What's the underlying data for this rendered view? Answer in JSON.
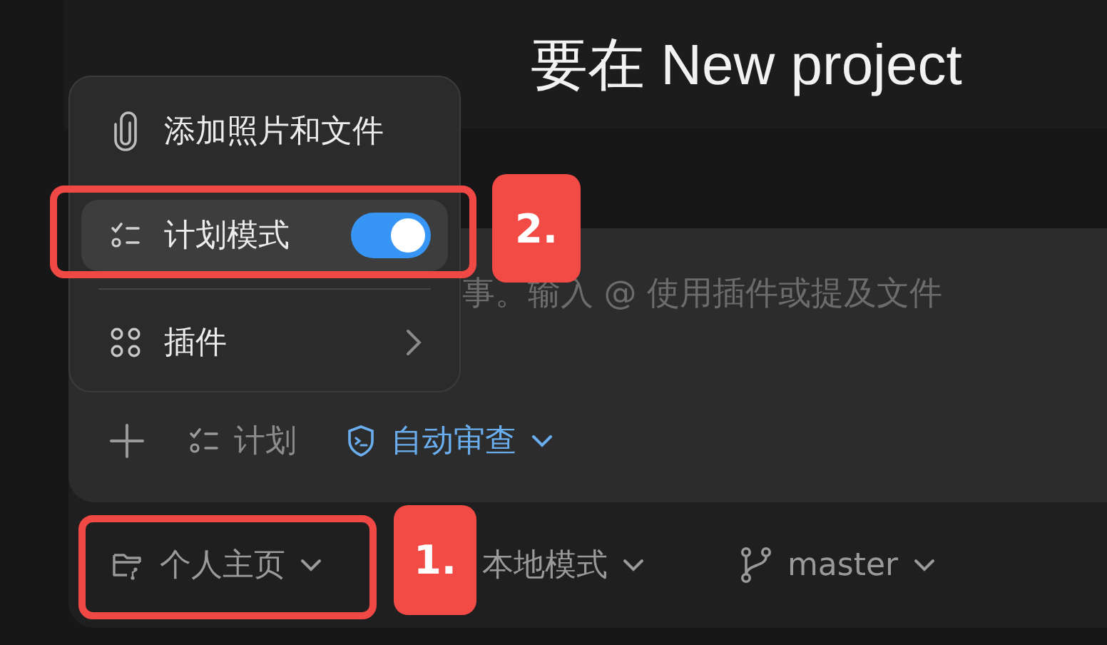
{
  "heading": "要在 New project",
  "composer": {
    "placeholder": "事。输入 @ 使用插件或提及文件",
    "toolbar": [
      {
        "kind": "add"
      },
      {
        "kind": "plan",
        "label": "计划"
      },
      {
        "kind": "review",
        "label": "自动审查"
      }
    ]
  },
  "menu": [
    {
      "kind": "attach",
      "label": "添加照片和文件"
    },
    {
      "kind": "toggle",
      "label": "计划模式",
      "on": true,
      "selected": true
    },
    {
      "kind": "submenu",
      "label": "插件"
    }
  ],
  "bottom_bar": [
    {
      "kind": "folder",
      "label": "个人主页"
    },
    {
      "kind": "mode",
      "label": "本地模式"
    },
    {
      "kind": "branch",
      "label": "master"
    }
  ],
  "annotations": [
    {
      "label": "1."
    },
    {
      "label": "2."
    }
  ]
}
